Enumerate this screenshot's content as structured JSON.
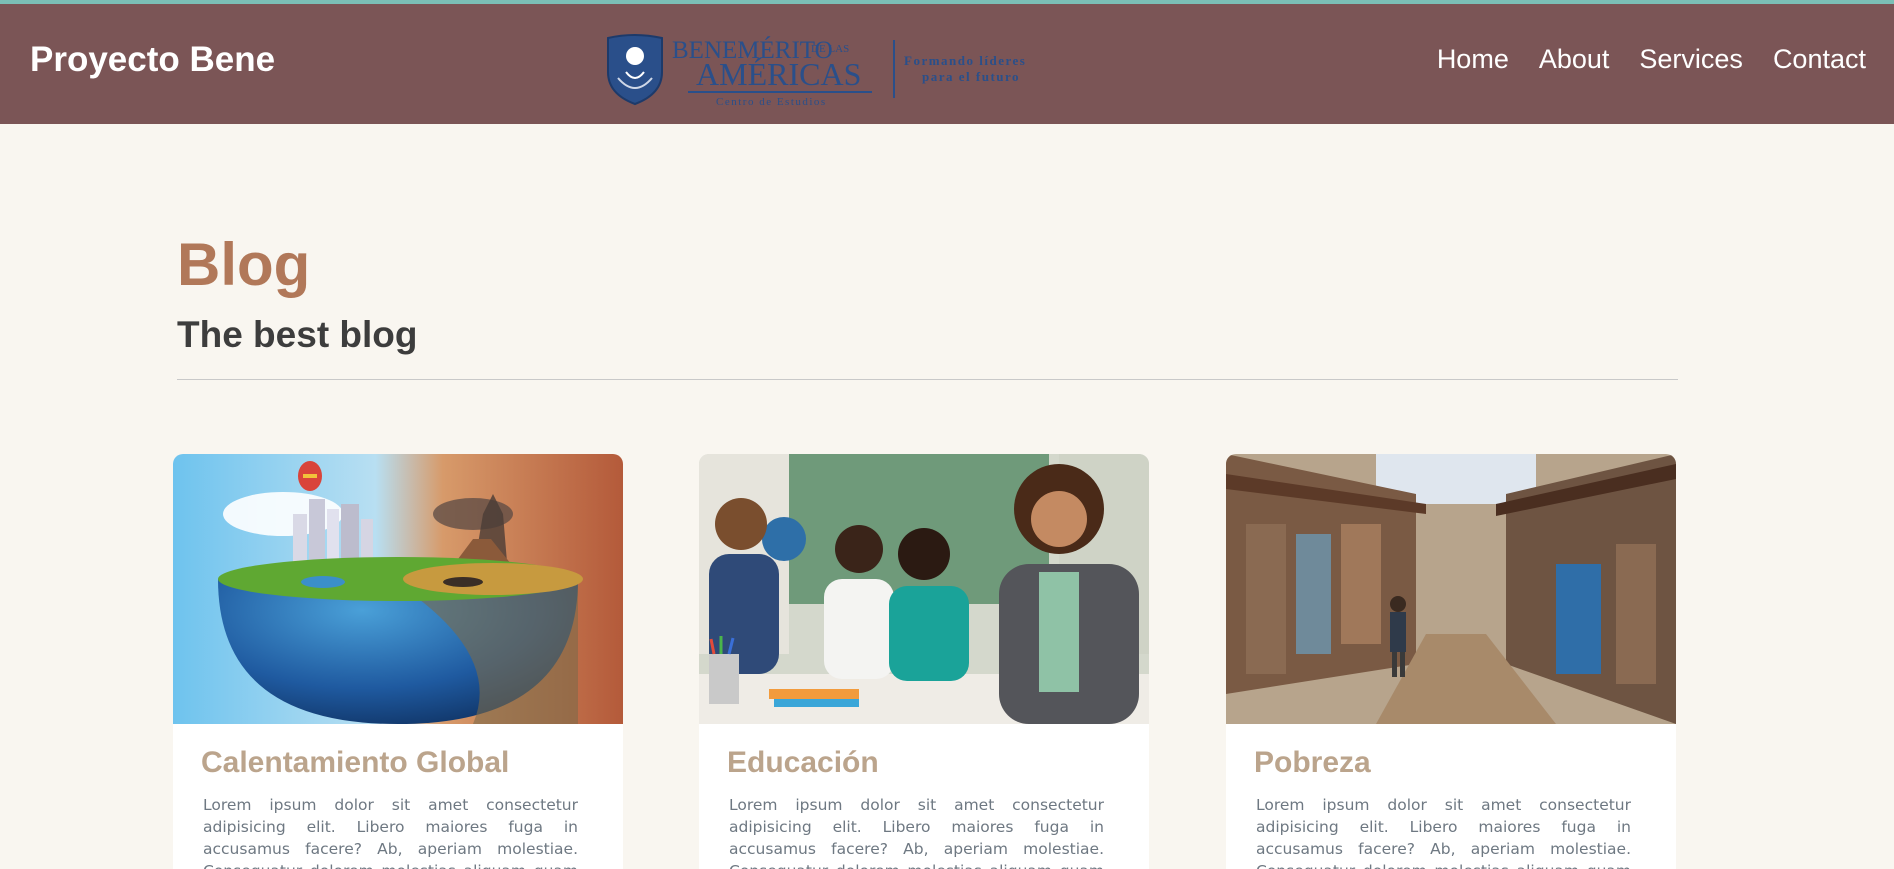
{
  "header": {
    "brand": "Proyecto Bene",
    "logo": {
      "name": "BENEMÉRITO",
      "de_las": "DE LAS",
      "americas": "AMÉRICAS",
      "sub": "Centro de Estudios",
      "tagline_line1": "Formando líderes",
      "tagline_line2": "para el futuro"
    },
    "nav": [
      {
        "label": "Home"
      },
      {
        "label": "About"
      },
      {
        "label": "Services"
      },
      {
        "label": "Contact"
      }
    ]
  },
  "main": {
    "title": "Blog",
    "subtitle": "The best blog"
  },
  "cards": [
    {
      "title": "Calentamiento Global",
      "text": "Lorem ipsum dolor sit amet consectetur adipisicing elit. Libero maiores fuga in accusamus facere? Ab, aperiam molestiae. Consequatur dolorem molestias aliquam quam nihil libero."
    },
    {
      "title": "Educación",
      "text": "Lorem ipsum dolor sit amet consectetur adipisicing elit. Libero maiores fuga in accusamus facere? Ab, aperiam molestiae. Consequatur dolorem molestias aliquam quam nihil libero."
    },
    {
      "title": "Pobreza",
      "text": "Lorem ipsum dolor sit amet consectetur adipisicing elit. Libero maiores fuga in accusamus facere? Ab, aperiam molestiae. Consequatur dolorem molestias aliquam quam nihil libero."
    }
  ],
  "colors": {
    "header_bg": "#7b5556",
    "accent_stripe": "#7bbfb6",
    "page_bg": "#f9f6f0",
    "blog_title": "#b17859",
    "card_title": "#bba48c",
    "logo_blue": "#2a4f8a"
  }
}
